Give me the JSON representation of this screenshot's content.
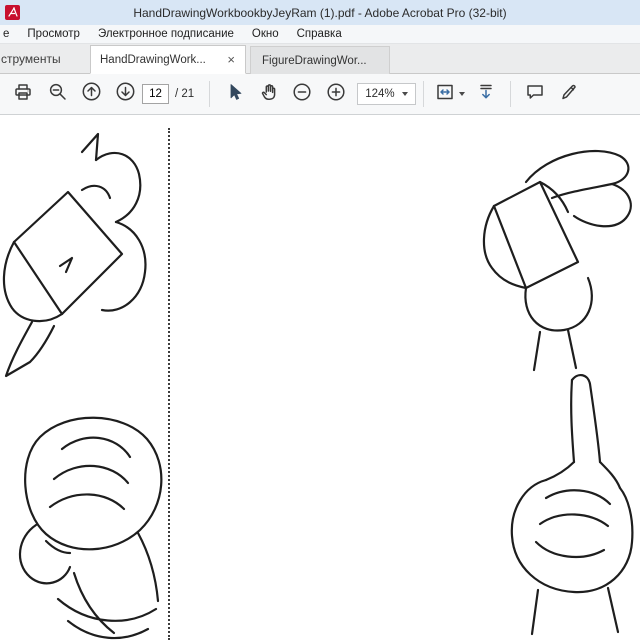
{
  "window": {
    "title": "HandDrawingWorkbookbyJeyRam (1).pdf - Adobe Acrobat Pro (32-bit)"
  },
  "menubar": {
    "items": [
      "е",
      "Просмотр",
      "Электронное подписание",
      "Окно",
      "Справка"
    ]
  },
  "tabbar": {
    "tools_label": "струменты",
    "tabs": [
      {
        "label": "HandDrawingWork...",
        "close_glyph": "×"
      },
      {
        "label": "FigureDrawingWor..."
      }
    ]
  },
  "toolbar": {
    "page_value": "12",
    "page_total_label": "/ 21",
    "zoom_value": "124%",
    "icons": {
      "print": "printer-icon",
      "marquee_zoom": "magnifier-icon",
      "previous_page": "circle-up-arrow-icon",
      "next_page": "circle-down-arrow-icon",
      "select_tool": "cursor-arrow-icon",
      "hand_tool": "hand-icon",
      "zoom_out": "circle-minus-icon",
      "zoom_in": "circle-plus-icon",
      "page_fit": "fit-width-icon",
      "scrolling_mode": "scroll-page-icon",
      "comment": "speech-bubble-icon",
      "fill_sign": "pencil-icon"
    }
  },
  "document": {
    "sketches": [
      {
        "name": "pinched-fingers-hand-sketch"
      },
      {
        "name": "clenched-fist-hand-sketch"
      },
      {
        "name": "relaxed-side-hand-sketch"
      },
      {
        "name": "pointing-finger-hand-sketch"
      }
    ]
  }
}
